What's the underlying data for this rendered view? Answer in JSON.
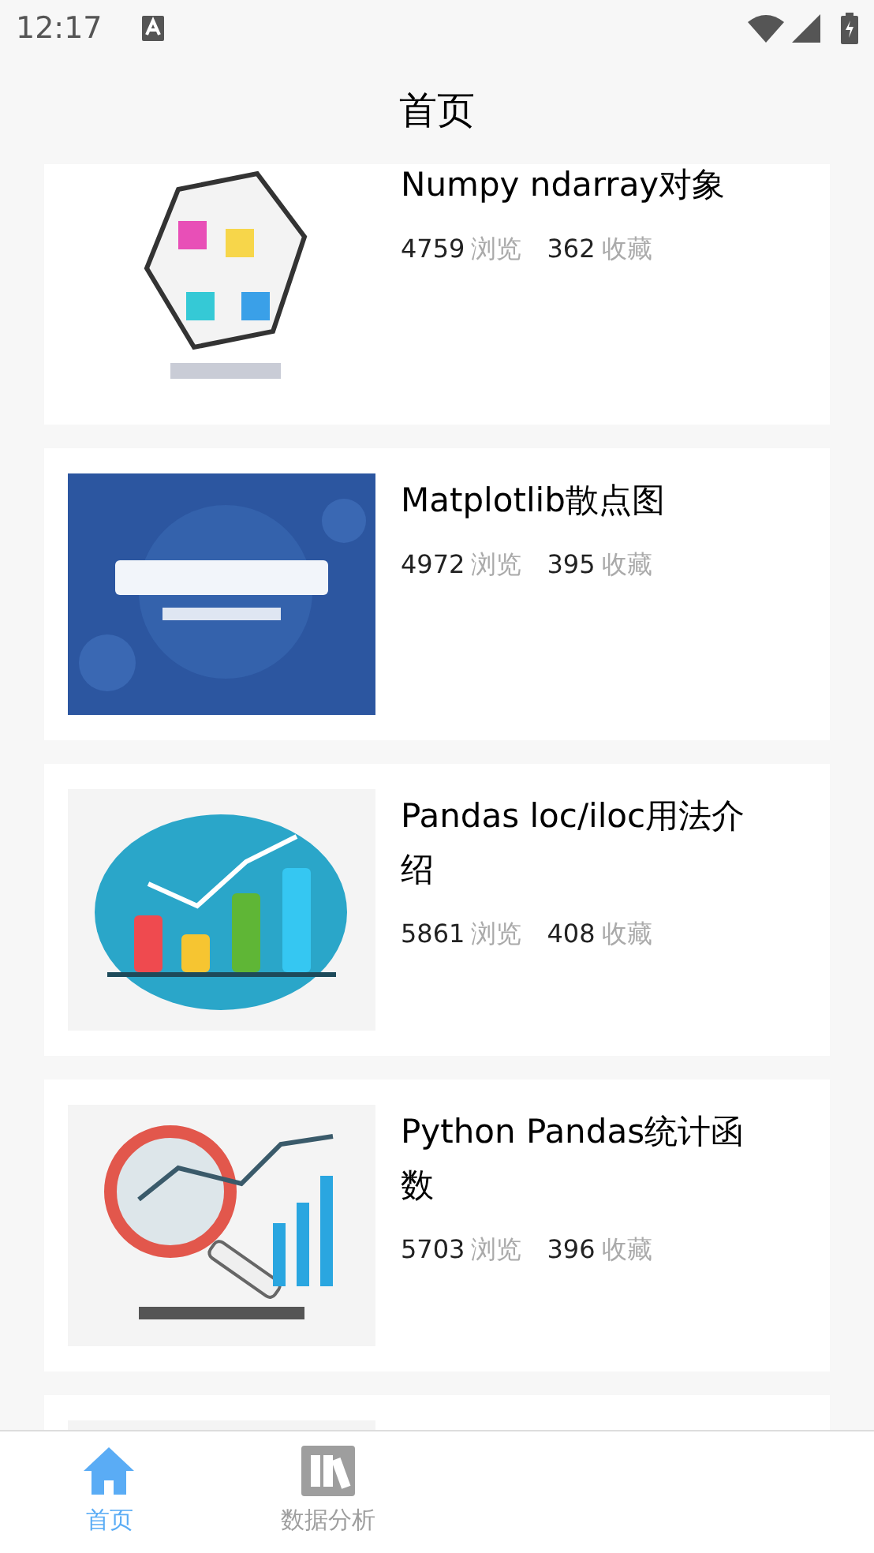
{
  "status_bar": {
    "time": "12:17"
  },
  "header": {
    "title": "首页"
  },
  "articles": [
    {
      "title": "Numpy ndarray对象",
      "views": "4759",
      "views_label": "浏览",
      "favorites": "362",
      "favorites_label": "收藏"
    },
    {
      "title": "Matplotlib散点图",
      "views": "4972",
      "views_label": "浏览",
      "favorites": "395",
      "favorites_label": "收藏"
    },
    {
      "title": "Pandas loc/iloc用法介绍",
      "views": "5861",
      "views_label": "浏览",
      "favorites": "408",
      "favorites_label": "收藏"
    },
    {
      "title": "Python Pandas统计函数",
      "views": "5703",
      "views_label": "浏览",
      "favorites": "396",
      "favorites_label": "收藏"
    },
    {
      "kind": "picture"
    }
  ],
  "tabs": [
    {
      "label": "首页",
      "selected": true
    },
    {
      "label": "数据分析",
      "selected": false
    }
  ]
}
